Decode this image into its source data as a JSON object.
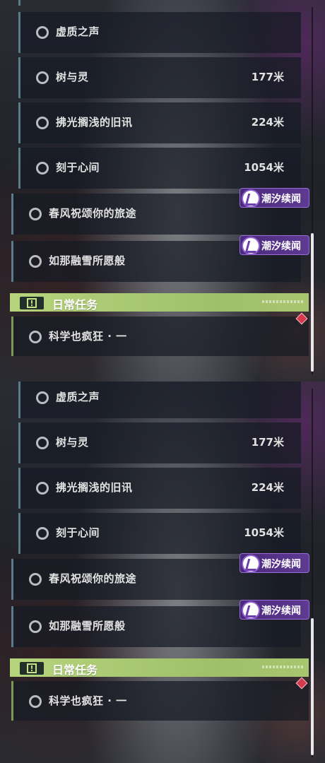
{
  "quests": [
    {
      "label": "虚质之声",
      "distance": ""
    },
    {
      "label": "树与灵",
      "distance": "177米"
    },
    {
      "label": "拂光搁浅的旧讯",
      "distance": "224米"
    },
    {
      "label": "刻于心间",
      "distance": "1054米"
    }
  ],
  "event_quests": [
    {
      "label": "春风祝颂你的旅途",
      "badge": "潮汐续闻"
    },
    {
      "label": "如那融雪所愿般",
      "badge": "潮汐续闻"
    }
  ],
  "daily_section": {
    "title": "日常任务",
    "items": [
      {
        "label": "科学也疯狂 · 一"
      }
    ]
  },
  "colors": {
    "accent_daily": "#b5d47c",
    "badge_purple": "#5e3a92",
    "marker_red": "#d43a4a",
    "row_border": "#5b7a8a"
  },
  "icons": [
    "quest-circle-icon",
    "tide-badge-icon",
    "daily-alert-icon",
    "tracking-marker-icon"
  ]
}
